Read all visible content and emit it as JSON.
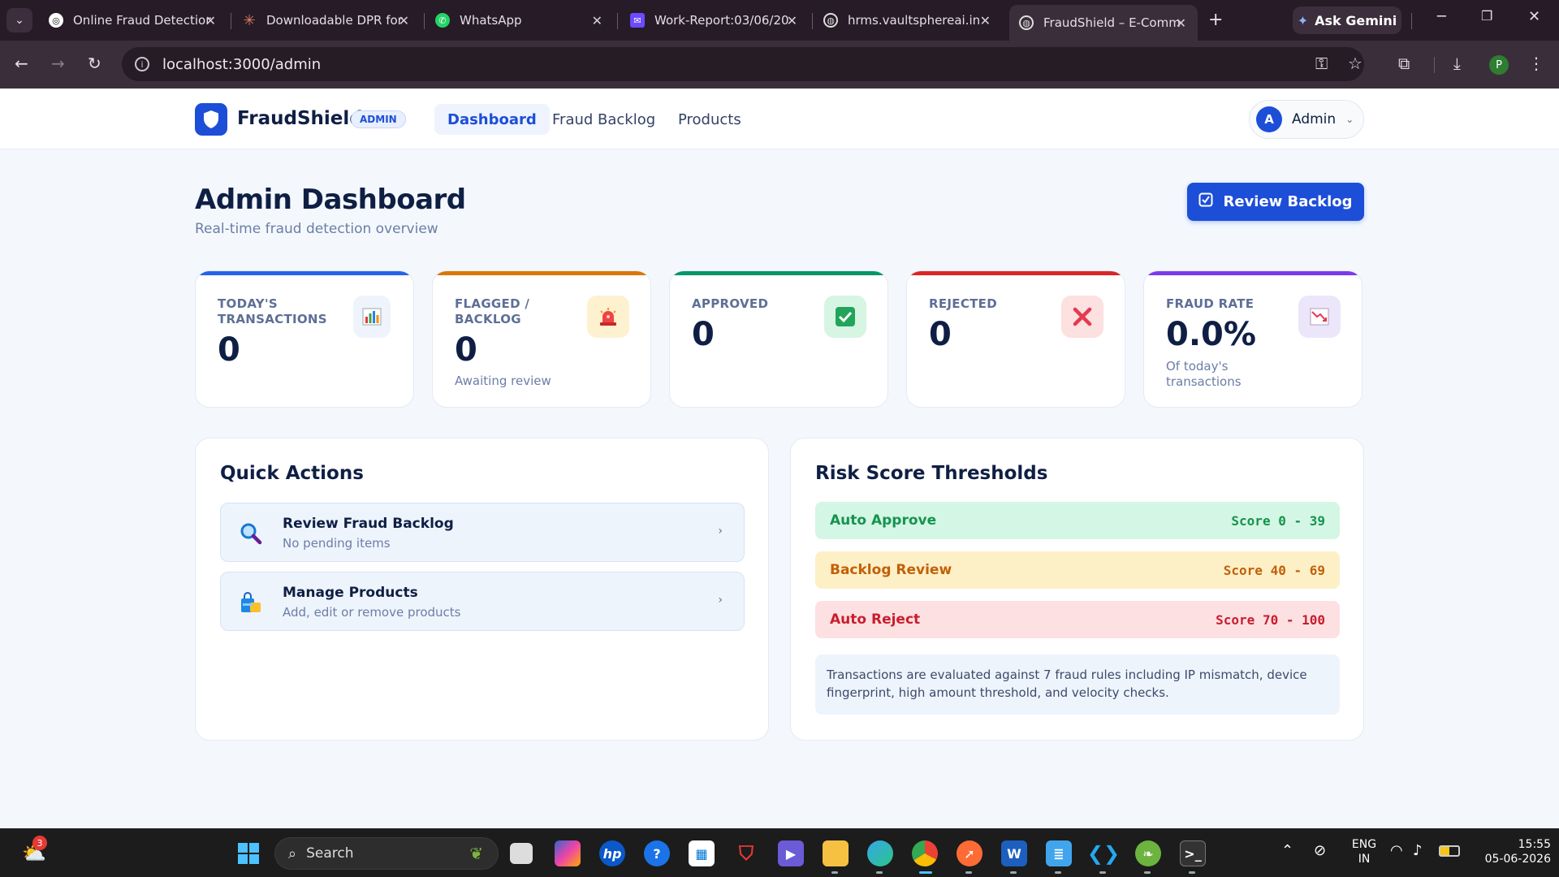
{
  "browser": {
    "tabs": [
      {
        "title": "Online Fraud Detection",
        "icon": "chatgpt-icon"
      },
      {
        "title": "Downloadable DPR for",
        "icon": "claude-icon"
      },
      {
        "title": "WhatsApp",
        "icon": "whatsapp-icon"
      },
      {
        "title": "Work-Report:03/06/20",
        "icon": "proton-mail-icon"
      },
      {
        "title": "hrms.vaultsphereai.in",
        "icon": "globe-icon"
      },
      {
        "title": "FraudShield – E-Comm",
        "icon": "globe-icon",
        "active": true
      }
    ],
    "ask_gemini": "Ask Gemini",
    "url": "localhost:3000/admin",
    "profile_initial": "P"
  },
  "app": {
    "brand": "FraudShield",
    "role_badge": "ADMIN",
    "nav": [
      "Dashboard",
      "Fraud Backlog",
      "Products"
    ],
    "user": {
      "initial": "A",
      "name": "Admin"
    }
  },
  "header": {
    "title": "Admin Dashboard",
    "subtitle": "Real-time fraud detection overview",
    "review_button": "Review Backlog"
  },
  "stats": [
    {
      "label": "TODAY'S TRANSACTIONS",
      "value": "0",
      "note": "",
      "accent": "#2563eb",
      "icon": "bar-chart-icon"
    },
    {
      "label": "FLAGGED / BACKLOG",
      "value": "0",
      "note": "Awaiting review",
      "accent": "#d97706",
      "icon": "siren-icon"
    },
    {
      "label": "APPROVED",
      "value": "0",
      "note": "",
      "accent": "#059669",
      "icon": "check-box-icon"
    },
    {
      "label": "REJECTED",
      "value": "0",
      "note": "",
      "accent": "#dc2626",
      "icon": "cross-icon"
    },
    {
      "label": "FRAUD RATE",
      "value": "0.0%",
      "note": "Of today's transactions",
      "accent": "#7c3aed",
      "icon": "trend-down-icon"
    }
  ],
  "quick_actions": {
    "title": "Quick Actions",
    "items": [
      {
        "title": "Review Fraud Backlog",
        "subtitle": "No pending items",
        "icon": "magnifier-icon"
      },
      {
        "title": "Manage Products",
        "subtitle": "Add, edit or remove products",
        "icon": "shopping-bag-icon"
      }
    ]
  },
  "risk": {
    "title": "Risk Score Thresholds",
    "rows": [
      {
        "label": "Auto Approve",
        "score": "Score 0 - 39"
      },
      {
        "label": "Backlog Review",
        "score": "Score 40 - 69"
      },
      {
        "label": "Auto Reject",
        "score": "Score 70 - 100"
      }
    ],
    "note": "Transactions are evaluated against 7 fraud rules including IP mismatch, device fingerprint, high amount threshold, and velocity checks."
  },
  "taskbar": {
    "weather_badge": "3",
    "search": "Search",
    "lang": "ENG",
    "region": "IN",
    "time": "15:55",
    "date": "05-06-2026"
  }
}
